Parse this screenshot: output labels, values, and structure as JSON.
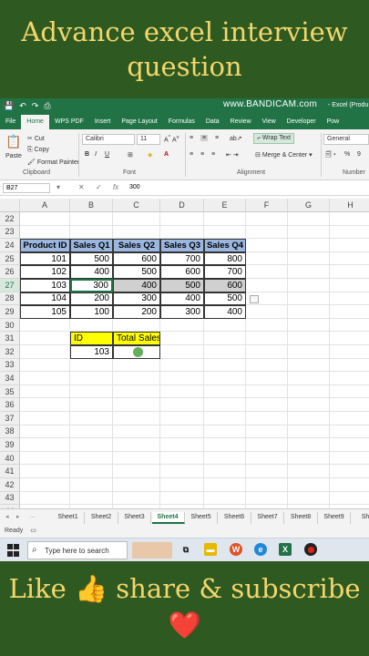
{
  "banner": {
    "line1": "Advance excel interview",
    "line2": "question",
    "cta": "Like 👍 share & subscribe",
    "heart": "❤️"
  },
  "titlebar": {
    "bandicam": "www.BANDICAM.com",
    "window_title": "- Excel (Produ"
  },
  "tabs": [
    "File",
    "Home",
    "WPS PDF",
    "Insert",
    "Page Layout",
    "Formulas",
    "Data",
    "Review",
    "View",
    "Developer",
    "Pow"
  ],
  "ribbon": {
    "paste": "Paste",
    "cut": "Cut",
    "copy": "Copy",
    "format_painter": "Format Painter",
    "clipboard": "Clipboard",
    "font_name": "Calibri",
    "font_size": "11",
    "font_group": "Font",
    "wrap_text": "Wrap Text",
    "merge_center": "Merge & Center",
    "alignment_group": "Alignment",
    "number_format": "General",
    "number_group": "Number",
    "percent": "%"
  },
  "formula_bar": {
    "name_box": "B27",
    "fx": "fx",
    "value": "300"
  },
  "columns": [
    "A",
    "B",
    "C",
    "D",
    "E",
    "F",
    "G",
    "H"
  ],
  "rows": [
    "22",
    "23",
    "24",
    "25",
    "26",
    "27",
    "28",
    "29",
    "30",
    "31",
    "32",
    "33",
    "34",
    "35",
    "36",
    "37",
    "38",
    "39",
    "40",
    "41",
    "42",
    "43",
    "44"
  ],
  "table": {
    "headers": [
      "Product ID",
      "Sales Q1",
      "Sales Q2",
      "Sales Q3",
      "Sales Q4"
    ],
    "rows": [
      [
        "101",
        "500",
        "600",
        "700",
        "800"
      ],
      [
        "102",
        "400",
        "500",
        "600",
        "700"
      ],
      [
        "103",
        "300",
        "400",
        "500",
        "600"
      ],
      [
        "104",
        "200",
        "300",
        "400",
        "500"
      ],
      [
        "105",
        "100",
        "200",
        "300",
        "400"
      ]
    ]
  },
  "lookup": {
    "id_label": "ID",
    "total_label": "Total Sales",
    "id_value": "103"
  },
  "sheets": [
    "Sheet1",
    "Sheet2",
    "Sheet3",
    "Sheet4",
    "Sheet5",
    "Sheet6",
    "Sheet7",
    "Sheet8",
    "Sheet9",
    "She"
  ],
  "active_sheet": "Sheet4",
  "status": "Ready",
  "taskbar": {
    "search_placeholder": "Type here to search"
  },
  "colors": {
    "excel_green": "#217346",
    "header_fill": "#9bb7e0",
    "yellow": "#ffff00",
    "banner_bg": "#2e5a22",
    "banner_text": "#f4d66b"
  }
}
